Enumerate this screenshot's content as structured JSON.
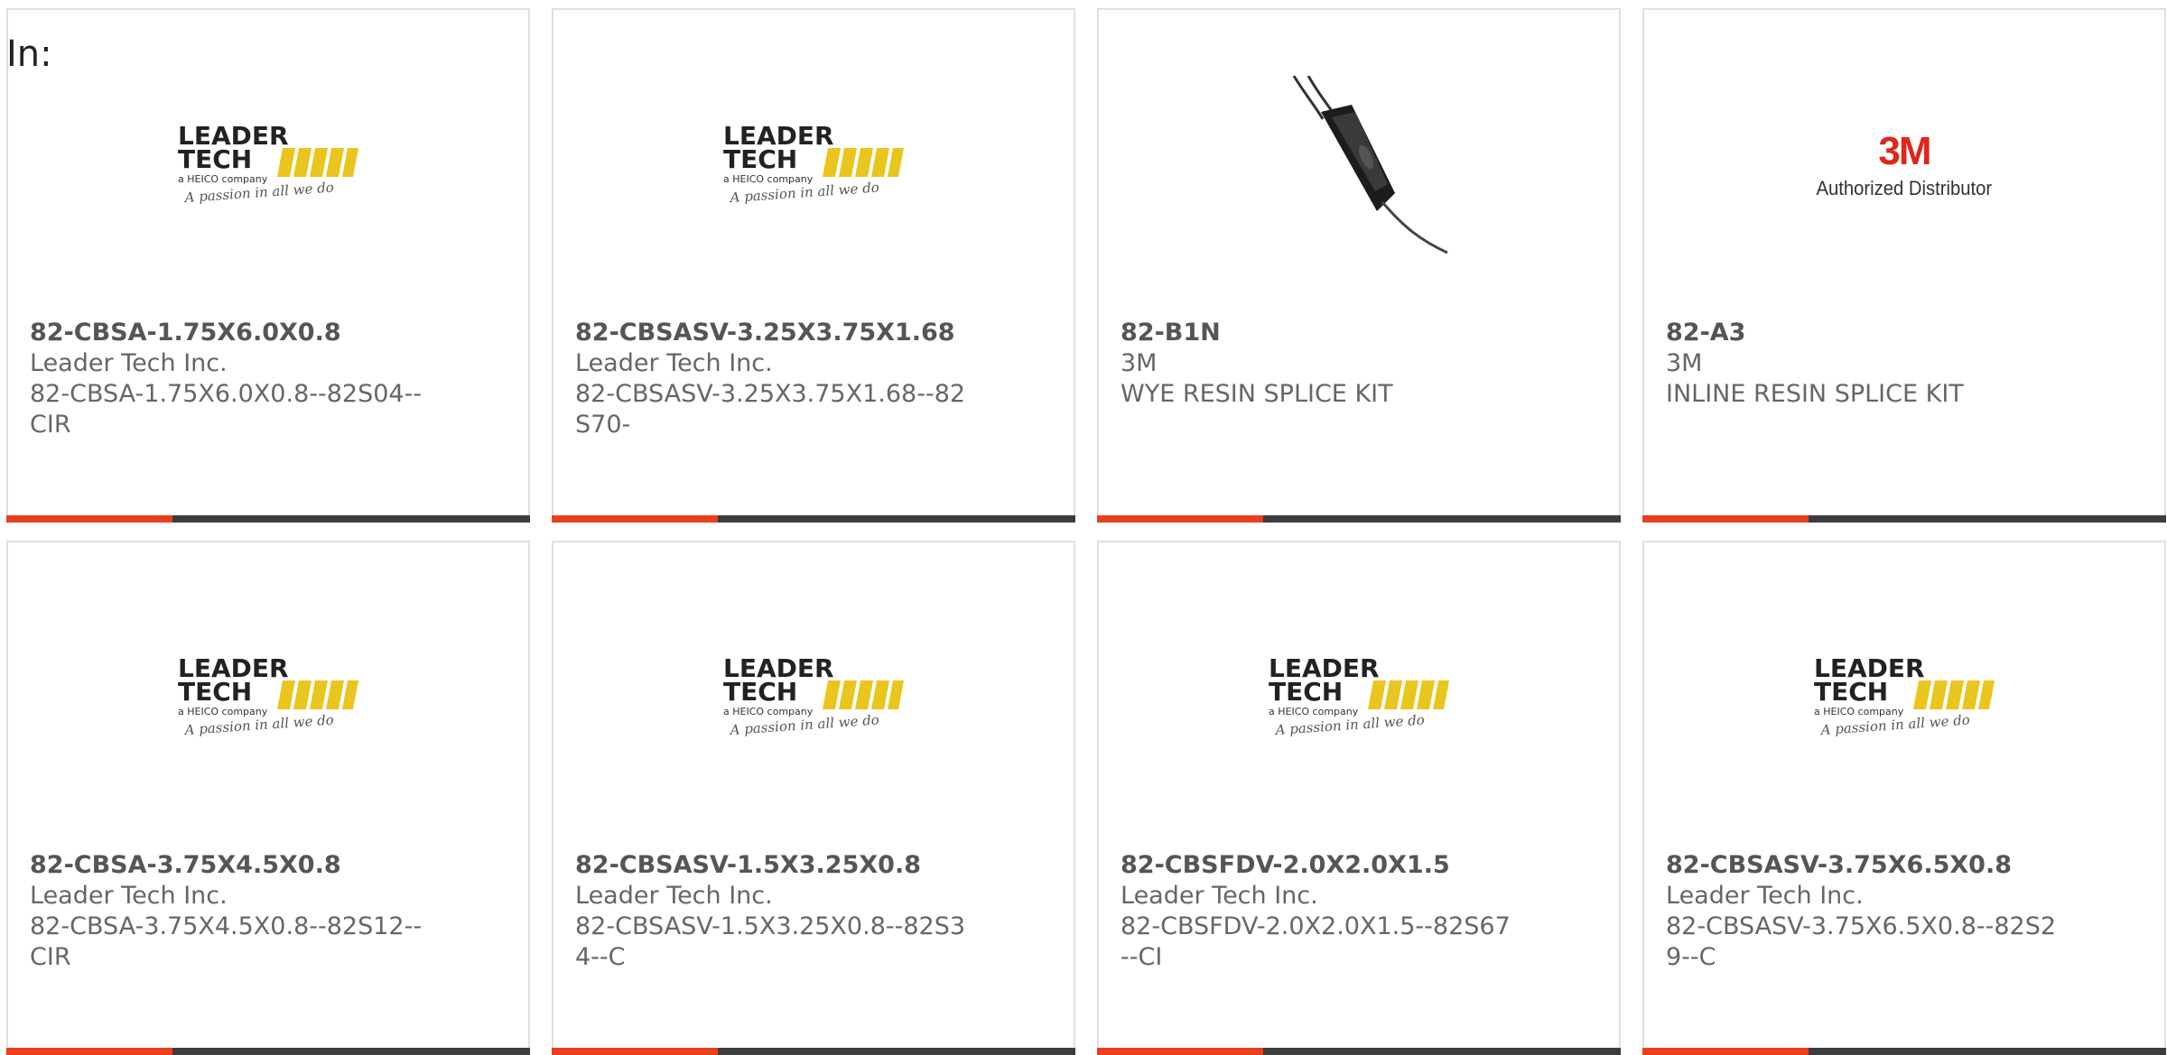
{
  "header": {
    "in_label": "In:"
  },
  "colors": {
    "accent": "#e8401c",
    "bar": "#3d3d3d",
    "border": "#e0e0e0",
    "text": "#666666"
  },
  "logos": {
    "leader_tech": {
      "line1": "LEADER",
      "line2": "TECH",
      "tagline": "a HEICO company",
      "slogan": "A passion in all we do"
    },
    "three_m": {
      "mark": "3M",
      "sub": "Authorized Distributor"
    }
  },
  "products": [
    {
      "image": "leader-tech-logo",
      "part_number": "82-CBSA-1.75X6.0X0.8",
      "manufacturer": "Leader Tech Inc.",
      "description": "82-CBSA-1.75X6.0X0.8--82S04--CIR"
    },
    {
      "image": "leader-tech-logo",
      "part_number": "82-CBSASV-3.25X3.75X1.68",
      "manufacturer": "Leader Tech Inc.",
      "description": "82-CBSASV-3.25X3.75X1.68--82S70-"
    },
    {
      "image": "splice-kit-photo",
      "part_number": "82-B1N",
      "manufacturer": "3M",
      "description": "WYE RESIN SPLICE KIT"
    },
    {
      "image": "3m-logo",
      "part_number": "82-A3",
      "manufacturer": "3M",
      "description": "INLINE RESIN SPLICE KIT"
    },
    {
      "image": "leader-tech-logo",
      "part_number": "82-CBSA-3.75X4.5X0.8",
      "manufacturer": "Leader Tech Inc.",
      "description": "82-CBSA-3.75X4.5X0.8--82S12--CIR"
    },
    {
      "image": "leader-tech-logo",
      "part_number": "82-CBSASV-1.5X3.25X0.8",
      "manufacturer": "Leader Tech Inc.",
      "description": "82-CBSASV-1.5X3.25X0.8--82S34--C"
    },
    {
      "image": "leader-tech-logo",
      "part_number": "82-CBSFDV-2.0X2.0X1.5",
      "manufacturer": "Leader Tech Inc.",
      "description": "82-CBSFDV-2.0X2.0X1.5--82S67--CI"
    },
    {
      "image": "leader-tech-logo",
      "part_number": "82-CBSASV-3.75X6.5X0.8",
      "manufacturer": "Leader Tech Inc.",
      "description": "82-CBSASV-3.75X6.5X0.8--82S29--C"
    }
  ]
}
